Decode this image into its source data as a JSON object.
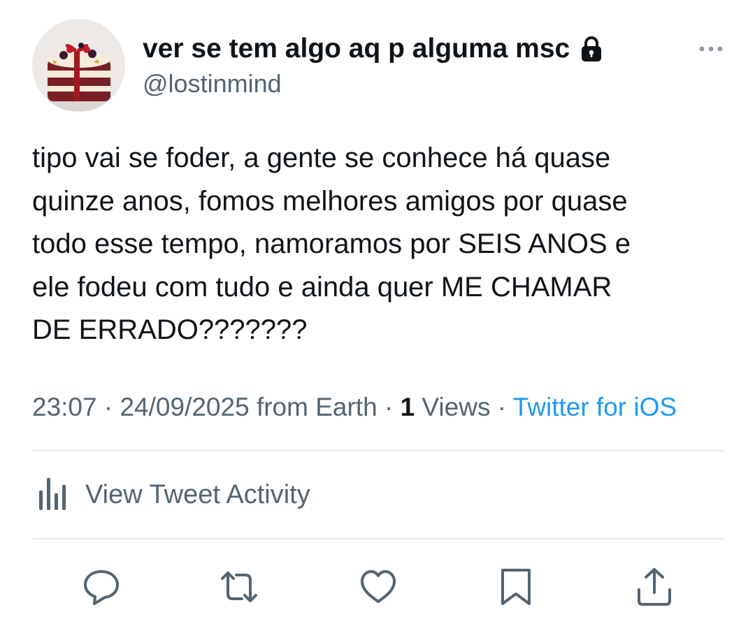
{
  "tweet": {
    "display_name": "ver se tem algo aq p alguma msc",
    "handle": "@lostinmind",
    "protected_icon": "lock-icon",
    "avatar_icon": "cake-avatar",
    "text": "tipo vai se foder, a gente se conhece há quase\nquinze anos, fomos melhores amigos por quase\ntodo esse tempo, namoramos por SEIS ANOS e\nele fodeu com tudo e ainda quer ME CHAMAR\nDE ERRADO???????",
    "time": "23:07",
    "date": "24/09/2025",
    "location": "from Earth",
    "separator": "·",
    "views_count": "1",
    "views_label": "Views",
    "source": "Twitter for iOS"
  },
  "activity": {
    "label": "View Tweet Activity",
    "icon": "bar-chart-icon"
  },
  "actions": [
    {
      "name": "reply",
      "icon": "reply-icon"
    },
    {
      "name": "retweet",
      "icon": "retweet-icon"
    },
    {
      "name": "like",
      "icon": "heart-icon"
    },
    {
      "name": "bookmark",
      "icon": "bookmark-icon"
    },
    {
      "name": "share",
      "icon": "share-icon"
    }
  ],
  "colors": {
    "text": "#0f1419",
    "secondary": "#536471",
    "link": "#1d9bf0",
    "divider": "#e4e8eb"
  }
}
